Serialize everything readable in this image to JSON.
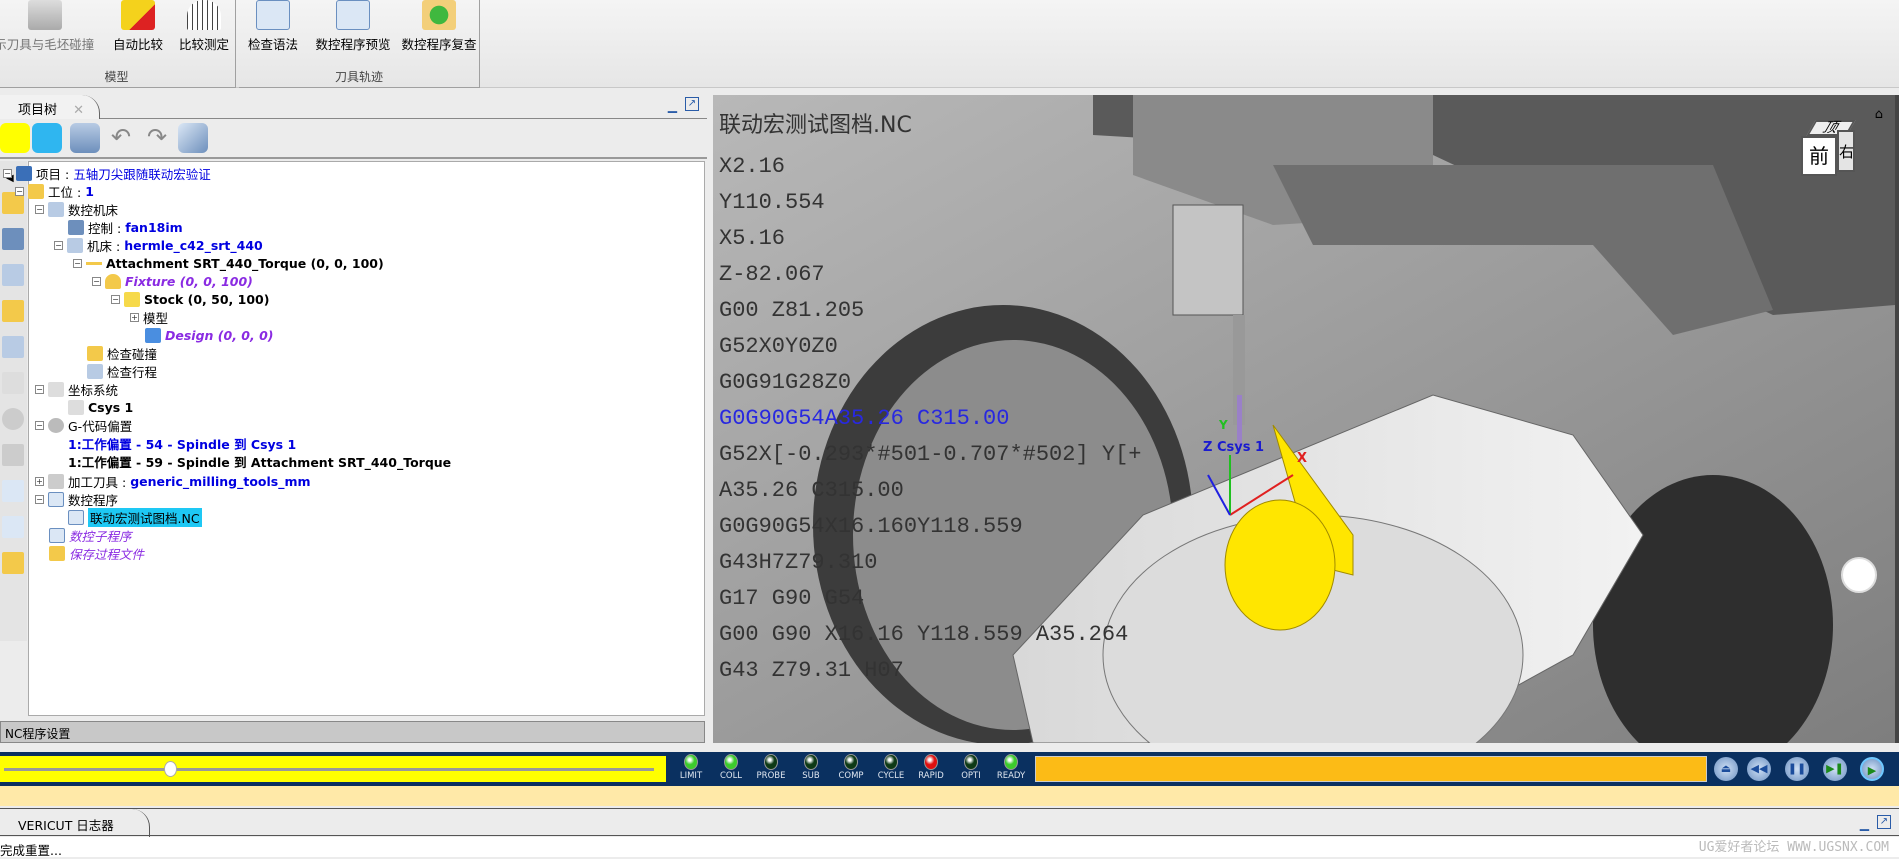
{
  "ribbon": {
    "groups": [
      {
        "label": "模型",
        "buttons": [
          "显示刀具与毛坯碰撞",
          "自动比较",
          "比较测定"
        ]
      },
      {
        "label": "刀具轨迹",
        "buttons": [
          "检查语法",
          "数控程序预览",
          "数控程序复查"
        ]
      }
    ]
  },
  "panel": {
    "tab_label": "项目树",
    "tree": {
      "project_label": "项目 : ",
      "project_name": "五轴刀尖跟随联动宏验证",
      "setup_label": "工位 : ",
      "setup_value": "1",
      "machine_group": "数控机床",
      "control_label": "控制 : ",
      "control_value": "fan18im",
      "machine_label": "机床 : ",
      "machine_value": "hermle_c42_srt_440",
      "attachment": "Attachment SRT_440_Torque (0, 0, 100)",
      "fixture": "Fixture (0, 0, 100)",
      "stock": "Stock (0, 50, 100)",
      "model": "模型",
      "design": "Design (0, 0, 0)",
      "collision": "检查碰撞",
      "travel": "检查行程",
      "csys_group": "坐标系统",
      "csys1": "Csys 1",
      "gcode_offsets": "G-代码偏置",
      "offset1": "1:工作偏置 - 54 - Spindle 到 Csys 1",
      "offset2": "1:工作偏置 - 59 - Spindle 到 Attachment SRT_440_Torque",
      "tools_label": "加工刀具 : ",
      "tools_value": "generic_milling_tools_mm",
      "nc_programs": "数控程序",
      "nc_file": "联动宏测试图档.NC",
      "subprograms": "数控子程序",
      "save_process": "保存过程文件"
    },
    "nc_settings_label": "NC程序设置"
  },
  "viewport": {
    "file_title": "联动宏测试图档.NC",
    "code_lines": [
      "X2.16",
      "Y110.554",
      "X5.16",
      "Z-82.067",
      "G00 Z81.205",
      "G52X0Y0Z0",
      "G0G91G28Z0",
      "G0G90G54A35.26 C315.00",
      "G52X[-0.293*#501-0.707*#502] Y[+",
      "A35.26 C315.00",
      "G0G90G54X16.160Y118.559",
      "G43H7Z79.310",
      "G17 G90 G54",
      "G00 G90 X16.16 Y118.559 A35.264",
      "G43 Z79.31 H07"
    ],
    "current_line_index": 7,
    "csys_label": "Z Csys 1",
    "axis_x": "X",
    "axis_y": "Y",
    "cube": {
      "top": "顶",
      "front": "前",
      "right": "右"
    }
  },
  "control_bar": {
    "slider_fraction": 0.25,
    "leds": [
      {
        "label": "LIMIT",
        "color": "#3ccc2c"
      },
      {
        "label": "COLL",
        "color": "#3ccc2c"
      },
      {
        "label": "PROBE",
        "color": "#0e3a16"
      },
      {
        "label": "SUB",
        "color": "#0e3a16"
      },
      {
        "label": "COMP",
        "color": "#0e3a16"
      },
      {
        "label": "CYCLE",
        "color": "#0e3a16"
      },
      {
        "label": "RAPID",
        "color": "#e01010"
      },
      {
        "label": "OPTI",
        "color": "#0e3a16"
      },
      {
        "label": "READY",
        "color": "#3ccc2c"
      }
    ],
    "playback": [
      "rewind-to-start",
      "step-back",
      "pause",
      "step-forward",
      "play"
    ]
  },
  "log": {
    "tab_label": "VERICUT 日志器",
    "status_text": "完成重置..."
  },
  "watermark": "UG爱好者论坛 WWW.UGSNX.COM"
}
